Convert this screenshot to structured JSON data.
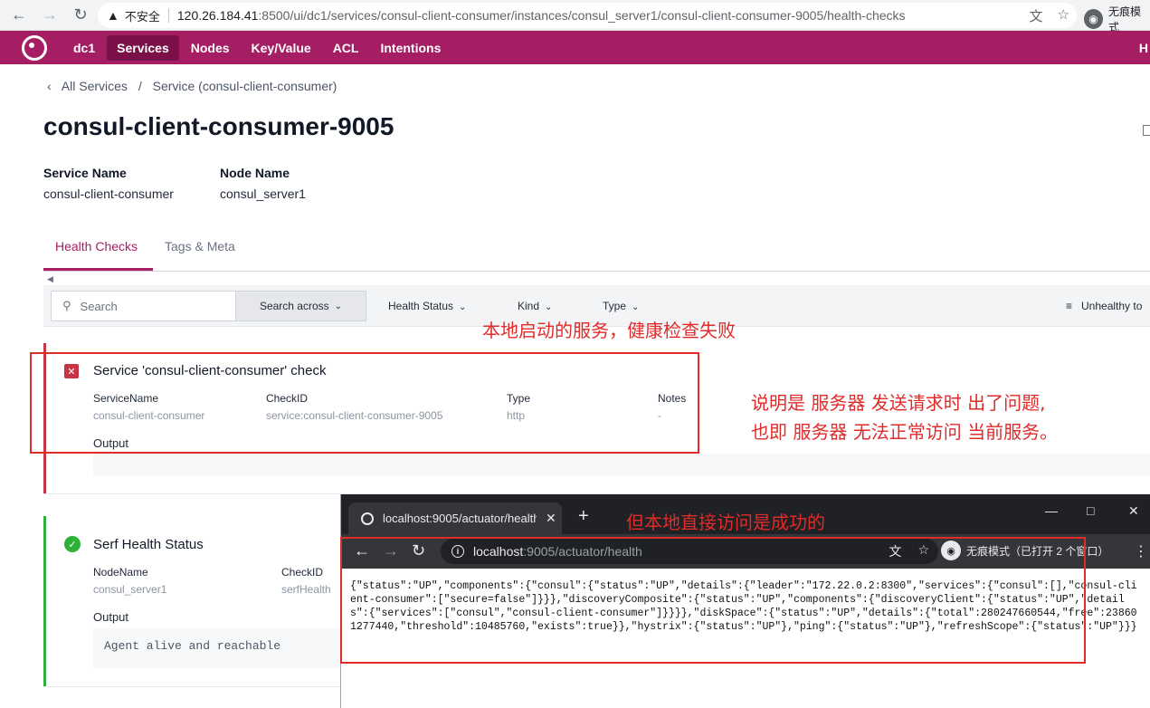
{
  "browser": {
    "insecure_label": "不安全",
    "url_host": "120.26.184.41",
    "url_rest": ":8500/ui/dc1/services/consul-client-consumer/instances/consul_server1/consul-client-consumer-9005/health-checks",
    "incognito_label": "无痕模式",
    "icons": [
      "back-icon",
      "forward-icon",
      "reload-icon",
      "warning-icon",
      "translate-icon",
      "star-icon",
      "incognito-icon"
    ]
  },
  "nav": {
    "dc": "dc1",
    "items": [
      "Services",
      "Nodes",
      "Key/Value",
      "ACL",
      "Intentions"
    ],
    "active": "Services",
    "right_cut": "H",
    "brand_color": "#a51e63"
  },
  "breadcrumb": {
    "all_services": "All Services",
    "service": "Service (consul-client-consumer)"
  },
  "page_title": "consul-client-consumer-9005",
  "meta": {
    "service_name_label": "Service Name",
    "service_name": "consul-client-consumer",
    "node_name_label": "Node Name",
    "node_name": "consul_server1"
  },
  "tabs": [
    "Health Checks",
    "Tags & Meta"
  ],
  "filters": {
    "search_placeholder": "Search",
    "search_across": "Search across",
    "health_status": "Health Status",
    "kind": "Kind",
    "type": "Type",
    "sort": "Unhealthy to"
  },
  "checks": [
    {
      "status": "critical",
      "title": "Service 'consul-client-consumer' check",
      "fields": [
        {
          "key": "ServiceName",
          "value": "consul-client-consumer"
        },
        {
          "key": "CheckID",
          "value": "service:consul-client-consumer-9005"
        },
        {
          "key": "Type",
          "value": "http"
        },
        {
          "key": "Notes",
          "value": "-"
        }
      ],
      "output_label": "Output",
      "output": ""
    },
    {
      "status": "passing",
      "title": "Serf Health Status",
      "fields": [
        {
          "key": "NodeName",
          "value": "consul_server1"
        },
        {
          "key": "CheckID",
          "value": "serfHealth"
        }
      ],
      "output_label": "Output",
      "output": "Agent alive and reachable"
    }
  ],
  "annotations": {
    "local_fail": "本地启动的服务，健康检查失败",
    "explain_line1": "说明是 服务器 发送请求时 出了问题,",
    "explain_line2": "也即 服务器 无法正常访问 当前服务。",
    "local_success": "但本地直接访问是成功的",
    "color": "#e02b2b"
  },
  "overlay": {
    "tab_title": "localhost:9005/actuator/health",
    "url_host": "localhost",
    "url_rest": ":9005/actuator/health",
    "incognito_label": "无痕模式（已打开 2 个窗口）",
    "body": "{\"status\":\"UP\",\"components\":{\"consul\":{\"status\":\"UP\",\"details\":{\"leader\":\"172.22.0.2:8300\",\"services\":{\"consul\":[],\"consul-client-consumer\":[\"secure=false\"]}}},\"discoveryComposite\":{\"status\":\"UP\",\"components\":{\"discoveryClient\":{\"status\":\"UP\",\"details\":{\"services\":[\"consul\",\"consul-client-consumer\"]}}}},\"diskSpace\":{\"status\":\"UP\",\"details\":{\"total\":280247660544,\"free\":238601277440,\"threshold\":10485760,\"exists\":true}},\"hystrix\":{\"status\":\"UP\"},\"ping\":{\"status\":\"UP\"},\"refreshScope\":{\"status\":\"UP\"}}}"
  }
}
